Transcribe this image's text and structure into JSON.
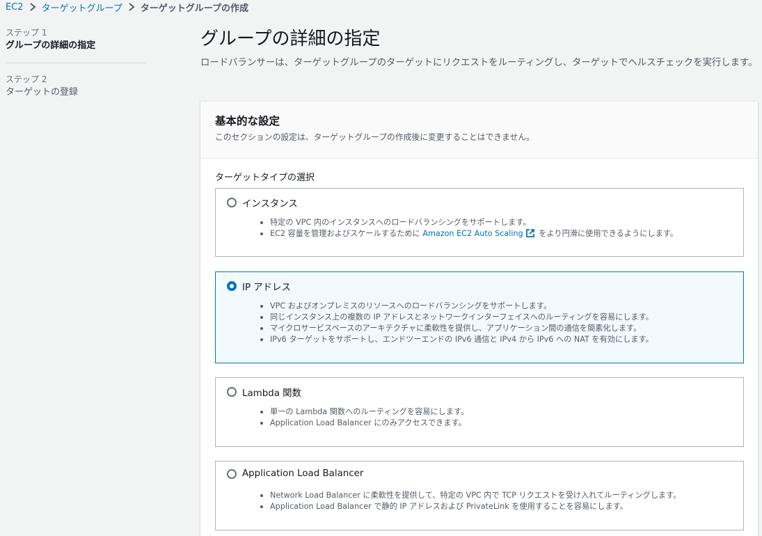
{
  "breadcrumb": {
    "items": [
      {
        "label": "EC2"
      },
      {
        "label": "ターゲットグループ"
      },
      {
        "label": "ターゲットグループの作成"
      }
    ]
  },
  "steps": [
    {
      "step": "ステップ 1",
      "title": "グループの詳細の指定",
      "active": true
    },
    {
      "step": "ステップ 2",
      "title": "ターゲットの登録",
      "active": false
    }
  ],
  "page": {
    "title": "グループの詳細の指定",
    "description": "ロードバランサーは、ターゲットグループのターゲットにリクエストをルーティングし、ターゲットでヘルスチェックを実行します。"
  },
  "panel": {
    "title": "基本的な設定",
    "subtitle": "このセクションの設定は、ターゲットグループの作成後に変更することはできません。",
    "field_label": "ターゲットタイプの選択",
    "options": [
      {
        "title": "インスタンス",
        "selected": false,
        "bullets": [
          "特定の VPC 内のインスタンスへのロードバランシングをサポートします。",
          {
            "prefix": "EC2 容量を管理およびスケールするために ",
            "link": "Amazon EC2 Auto Scaling",
            "suffix": " をより円滑に使用できるようにします。"
          }
        ]
      },
      {
        "title": "IP アドレス",
        "selected": true,
        "bullets": [
          "VPC およびオンプレミスのリソースへのロードバランシングをサポートします。",
          "同じインスタンス上の複数の IP アドレスとネットワークインターフェイスへのルーティングを容易にします。",
          "マイクロサービスベースのアーキテクチャに柔軟性を提供し、アプリケーション間の通信を簡素化します。",
          "IPv6 ターゲットをサポートし、エンドツーエンドの IPv6 通信と IPv4 から IPv6 への NAT を有効にします。"
        ]
      },
      {
        "title": "Lambda 関数",
        "selected": false,
        "bullets": [
          "単一の Lambda 関数へのルーティングを容易にします。",
          "Application Load Balancer にのみアクセスできます。"
        ]
      },
      {
        "title": "Application Load Balancer",
        "selected": false,
        "bullets": [
          "Network Load Balancer に柔軟性を提供して、特定の VPC 内で TCP リクエストを受け入れてルーティングします。",
          "Application Load Balancer で静的 IP アドレスおよび PrivateLink を使用することを容易にします。"
        ]
      }
    ]
  },
  "colors": {
    "link": "#0073bb",
    "selected_border": "#0073bb",
    "selected_background": "#f1faff",
    "page_background": "#f2f3f3"
  }
}
